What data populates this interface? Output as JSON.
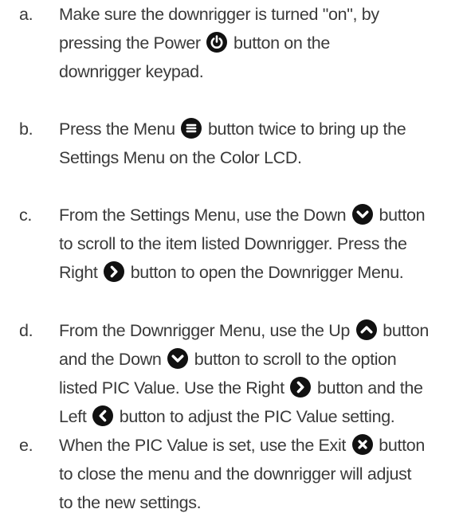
{
  "steps": [
    {
      "marker": "a.",
      "lines": [
        [
          "Make sure the downrigger is turned \"on\", by"
        ],
        [
          "pressing the Power",
          "button on the"
        ],
        [
          "downrigger keypad."
        ]
      ],
      "icons": [
        "power-icon"
      ]
    },
    {
      "marker": "b.",
      "lines": [
        [
          "Press the Menu",
          "button twice to bring up the"
        ],
        [
          "Settings Menu on the Color LCD."
        ]
      ],
      "icons": [
        "menu-icon"
      ]
    },
    {
      "marker": "c.",
      "lines": [
        [
          "From the Settings Menu, use the Down",
          "button"
        ],
        [
          "to scroll to the item listed Downrigger. Press the"
        ],
        [
          "Right",
          "button to open the Downrigger Menu."
        ]
      ],
      "icons": [
        "chevron-down-icon",
        "chevron-right-icon"
      ]
    },
    {
      "marker": "d.",
      "lines": [
        [
          "From the Downrigger Menu, use the Up",
          "button"
        ],
        [
          "and the Down",
          "button to scroll to the option"
        ],
        [
          "listed PIC Value. Use the Right",
          "button and the"
        ],
        [
          "Left",
          "button to adjust the PIC Value setting."
        ]
      ],
      "icons": [
        "chevron-up-icon",
        "chevron-down-icon",
        "chevron-right-icon",
        "chevron-left-icon"
      ]
    },
    {
      "marker": "e.",
      "lines": [
        [
          "When the PIC Value is set, use the Exit",
          "button"
        ],
        [
          "to close the menu and the downrigger will adjust"
        ],
        [
          "to the new settings."
        ]
      ],
      "icons": [
        "exit-icon"
      ]
    }
  ],
  "colors": {
    "text": "#3a3a3a",
    "icon_fill": "#111111",
    "icon_glyph": "#ffffff"
  }
}
